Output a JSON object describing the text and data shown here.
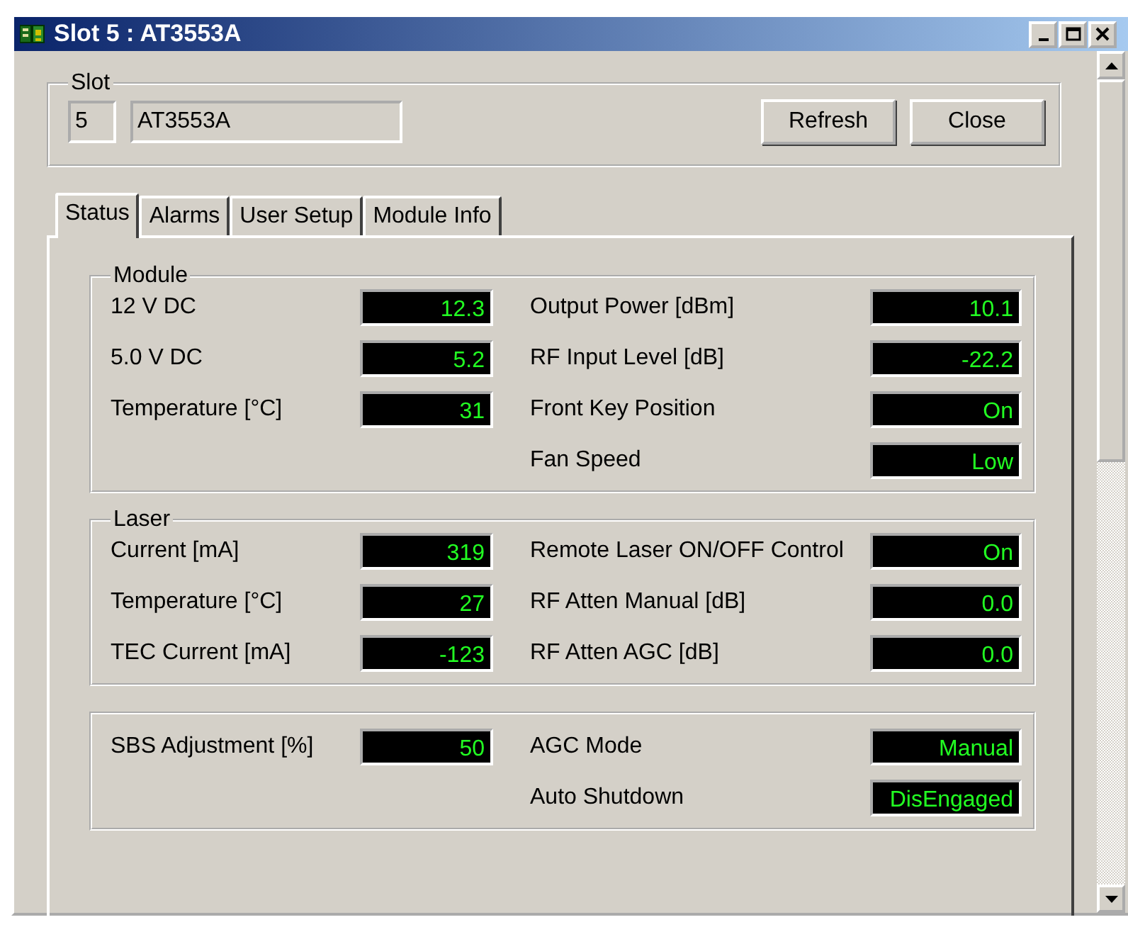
{
  "window": {
    "title": "Slot 5 : AT3553A"
  },
  "slot": {
    "title": "Slot",
    "number": "5",
    "model": "AT3553A",
    "buttons": [
      "Refresh",
      "Close"
    ]
  },
  "tabs": [
    {
      "label": "Status",
      "selected": true
    },
    {
      "label": "Alarms",
      "selected": false
    },
    {
      "label": "User Setup",
      "selected": false
    },
    {
      "label": "Module Info",
      "selected": false
    }
  ],
  "groups": [
    {
      "title": "Module",
      "left": [
        {
          "label": "12 V DC",
          "value": "12.3"
        },
        {
          "label": "5.0 V DC",
          "value": "5.2"
        },
        {
          "label": "Temperature [°C]",
          "value": "31"
        }
      ],
      "right": [
        {
          "label": "Output Power [dBm]",
          "value": "10.1"
        },
        {
          "label": "RF Input Level [dB]",
          "value": "-22.2"
        },
        {
          "label": "Front Key Position",
          "value": "On"
        },
        {
          "label": "Fan Speed",
          "value": "Low"
        }
      ]
    },
    {
      "title": "Laser",
      "left": [
        {
          "label": "Current [mA]",
          "value": "319"
        },
        {
          "label": "Temperature [°C]",
          "value": "27"
        },
        {
          "label": "TEC Current [mA]",
          "value": "-123"
        }
      ],
      "right": [
        {
          "label": "Remote Laser ON/OFF Control",
          "value": "On"
        },
        {
          "label": "RF Atten Manual [dB]",
          "value": "0.0"
        },
        {
          "label": "RF Atten AGC [dB]",
          "value": "0.0"
        }
      ]
    },
    {
      "left": [
        {
          "label": "SBS Adjustment [%]",
          "value": "50"
        }
      ],
      "right": [
        {
          "label": "AGC Mode",
          "value": "Manual"
        },
        {
          "label": "Auto Shutdown",
          "value": "DisEngaged"
        }
      ]
    }
  ]
}
